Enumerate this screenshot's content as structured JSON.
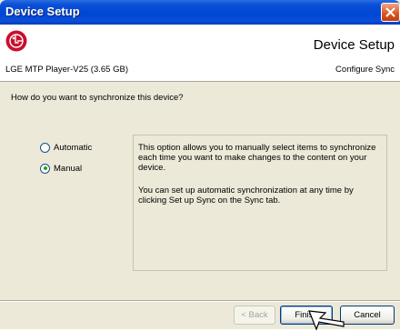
{
  "window": {
    "title": "Device Setup"
  },
  "header": {
    "title": "Device Setup",
    "device_name": "LGE MTP Player-V25 (3.65 GB)",
    "subtitle": "Configure Sync"
  },
  "main": {
    "question": "How do you want to synchronize this device?",
    "options": [
      {
        "label": "Automatic",
        "selected": false
      },
      {
        "label": "Manual",
        "selected": true
      }
    ],
    "description": [
      "This option allows you to manually select items to synchronize each time you want to make changes to the content on your device.",
      "You can set up automatic synchronization at any time by clicking Set up Sync on the Sync tab."
    ]
  },
  "footer": {
    "back_label": "< Back",
    "finish_label": "Finish",
    "cancel_label": "Cancel"
  },
  "colors": {
    "titlebar": "#0046d5",
    "close_button": "#d9531e",
    "logo": "#c8102e",
    "radio_checked": "#21a121",
    "dialog_bg": "#ece9d8"
  },
  "icons": {
    "close": "close-icon",
    "logo": "lg-logo-icon",
    "cursor": "mouse-cursor-icon"
  }
}
